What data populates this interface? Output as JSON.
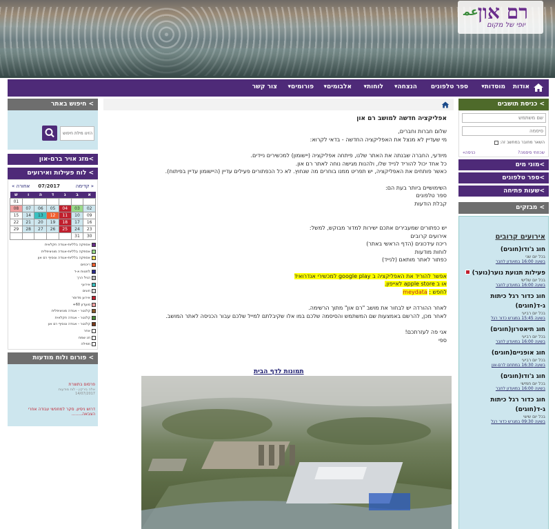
{
  "header": {
    "logo_main": "רם און",
    "logo_tagline": "יופי של מקום",
    "logo_mark": "ﻋﻤ"
  },
  "nav": {
    "items": [
      {
        "label": "אודות"
      },
      {
        "label": "מוסדות▾"
      },
      {
        "label": "ספר טלפונים"
      },
      {
        "label": "הנצחה▾"
      },
      {
        "label": "לוחות▾"
      },
      {
        "label": "אלבומים▾"
      },
      {
        "label": "פורומים▾"
      },
      {
        "label": "צור קשר"
      }
    ]
  },
  "login": {
    "title": "> כניסת תושבים",
    "username_placeholder": "שם משתמש",
    "password_placeholder": "סיסמה",
    "remember_label": "השאר מחובר במחשב זה:",
    "forgot_label": "שכחתי סיסמה?",
    "login_label": "כניסה»"
  },
  "right_links": [
    {
      "label": ">מוני מים"
    },
    {
      "label": ">ספר טלפונים"
    },
    {
      "label": ">שעות פתיחה"
    }
  ],
  "events": {
    "title": "> מבזקים",
    "heading": "אירועים קרובים",
    "items": [
      {
        "title": "חוג ג'ודו(חוגים)",
        "sub1": "בכל יום שני",
        "sub2": "בשעה 16:00 במועדון לחבר"
      },
      {
        "title": "פעילות תנועת נוער(נוער)",
        "sub1": "בכל יום שלישי",
        "sub2": "בשעה 16:00 במועדון לחבר"
      },
      {
        "title": "חוג כדור רגל כיתות ג-ד(חוגים)",
        "sub1": "בכל יום רביעי",
        "sub2": "בשעה 15:45 במגרש כדור רגל"
      },
      {
        "title": "חוג תיאטרון(חוגים)",
        "sub1": "בכל יום רביעי",
        "sub2": "בשעה 16:00 במועדון לחבר"
      },
      {
        "title": "חוג אופניים(חוגים)",
        "sub1": "בכל יום רביעי",
        "sub2": "בשעה 16:30 במתחם לרם-און"
      },
      {
        "title": "חוג ג'ודו(חוגים)",
        "sub1": "בכל יום חמישי",
        "sub2": "בשעה 16:00 במועדון לחבר"
      },
      {
        "title": "חוג כדור רגל כיתות ג-ד(חוגים)",
        "sub1": "בכל יום שישי",
        "sub2": "בשעה 09:30 במגרש כדור רגל"
      }
    ]
  },
  "search": {
    "title": "> חיפוש באתר",
    "placeholder": "הזינו מילת חיפוש"
  },
  "weather_link": ">מזג אויר ברם-און",
  "calendar": {
    "title": "> לוח פעילות ואירועים",
    "prev": "« קדימה",
    "month": "07/2017",
    "next": "אחורה »",
    "days": [
      "א",
      "ב",
      "ג",
      "ד",
      "ה",
      "ו",
      "ש"
    ],
    "weeks": [
      [
        "",
        "",
        "",
        "",
        "",
        "",
        "01"
      ],
      [
        "02",
        "03",
        "04",
        "05",
        "06",
        "07",
        "08"
      ],
      [
        "09",
        "10",
        "11",
        "12",
        "13",
        "14",
        "15"
      ],
      [
        "16",
        "17",
        "18",
        "19",
        "20",
        "21",
        "22"
      ],
      [
        "23",
        "24",
        "25",
        "26",
        "27",
        "28",
        "29"
      ],
      [
        "30",
        "31",
        "",
        "",
        "",
        "",
        ""
      ]
    ],
    "legend": [
      {
        "label": "אספקה בלליות-אגודה חקלאית",
        "color": "#6a2d8c"
      },
      {
        "label": "אספקה בלליות-אגודה מוניציפלית",
        "color": "#9adb8a"
      },
      {
        "label": "אספקה בלליות-אגודה ונוסיף רם און",
        "color": "#e8e060"
      },
      {
        "label": "ריכוזים",
        "color": "#f06030"
      },
      {
        "label": "לחטות א-ד",
        "color": "#2a2a8a"
      },
      {
        "label": "הגיל הרך",
        "color": "#bbbbbb"
      },
      {
        "label": "אירועי",
        "color": "#3ac0c0"
      },
      {
        "label": "חוגים",
        "color": "#dddddd"
      },
      {
        "label": "אירוע מדוסר",
        "color": "#c0202e"
      },
      {
        "label": "מועדון 60+",
        "color": "#f0a0a0"
      },
      {
        "label": "קלנטר - אגודה מוניציפלית",
        "color": "#8a5a2a"
      },
      {
        "label": "קלנטר - אגודה חקלאית",
        "color": "#4a8a3a"
      },
      {
        "label": "קלנטר - אגודה ונוסיף רם און",
        "color": "#7a3a1a"
      },
      {
        "label": "אחר",
        "color": "#ffffff"
      },
      {
        "label": "חג שמח",
        "color": "#ffffff"
      },
      {
        "label": "תפילה",
        "color": "#ffffff"
      }
    ]
  },
  "forum": {
    "title": "> פורום ולוח מודעות",
    "items": [
      {
        "text": "פרסום בתוצרת",
        "meta": "אלה בירקין - לוח מודעות 14/07/2017"
      },
      {
        "text": "דרוש ניסיון. סקר למחפשי עבודה אחרי הצבאה........",
        "meta": ""
      }
    ]
  },
  "main": {
    "title": "אפליקציה חדשה למושב רם און",
    "p1_a": "שלום חברות וחברים,",
    "p1_b": "מי שעדיין לא מנצל את האפליקציה החדשה - בדאי לקרוא:",
    "p2_a": "מיודעי, החברה שבנתה את האתר שלנו, פיתחה אפליקציה (יישומון) למכשירים ניידים.",
    "p2_b": "כל אחד יכול להוריד לנייד שלו, ולהנות מגישה נוחה לאתר רם און.",
    "p2_c": "כאשר פותחים את האפליקציה, יש תפריט ממנו בוחרים מה שנחוץ. לא כל הכפתורים פעילים עדיין (היישומון עדיין בפיתוח).",
    "p3_a": "השימושיים ביותר בעת הם:",
    "p3_b": "ספר טלפונים",
    "p3_c": "קבלת הודעות",
    "p4_a": "יש כפתורים שמעבירים אתכם ישירות למדור מבוקש, למשל:",
    "p4_b": "אירועים קרובים",
    "p4_c": "ריכוז עידכונים (הדף הראשי באתר)",
    "p4_d": "לוחות מודעות",
    "p4_e": "כפתור לאתר מותאם (לנייד)",
    "p5_a": "אפשר להוריד את האפליקציה ב google play למכשירי אנדרואיד",
    "p5_b": "או ב apple store לאייפון.",
    "p5_c_label": "לחפש :",
    "p5_c_value": "meydata",
    "p6_a": "לאחר ההורדה יש לבחור את מושב \"רם און\" מתוך הרשימה.",
    "p6_b": "לאחר מכן, להרשם באמצעות שם המשתמש והסיסמה שלכם במו אלו שקיבלתם למייל שלכם עבור הכניסה לאתר המושב.",
    "p7_a": "אני פה לעזרתכם!",
    "p7_b": "ספי",
    "pictures_title": "תמונות לדף הבית"
  }
}
